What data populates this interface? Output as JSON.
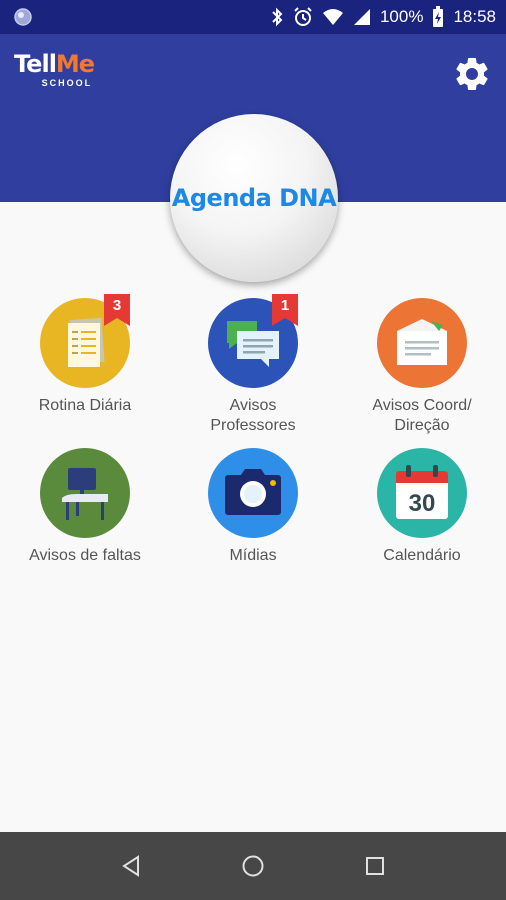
{
  "status_bar": {
    "battery": "100%",
    "time": "18:58"
  },
  "header": {
    "logo_tell": "Tell",
    "logo_me": "Me",
    "logo_sub": "SCHOOL"
  },
  "profile": {
    "name": "Agenda DNA"
  },
  "menu": [
    {
      "label": "Rotina Diária",
      "badge": "3",
      "color": "#e8b623",
      "icon": "document-icon"
    },
    {
      "label": "Avisos\nProfessores",
      "badge": "1",
      "color": "#2c53b8",
      "icon": "chat-bubbles-icon"
    },
    {
      "label": "Avisos Coord/\nDireção",
      "badge": null,
      "color": "#ec7434",
      "icon": "envelope-icon"
    },
    {
      "label": "Avisos de faltas",
      "badge": null,
      "color": "#5a8a3c",
      "icon": "school-desk-icon"
    },
    {
      "label": "Mídias",
      "badge": null,
      "color": "#2f8fe8",
      "icon": "camera-icon"
    },
    {
      "label": "Calendário",
      "badge": null,
      "color": "#2bb5a6",
      "icon": "calendar-icon"
    }
  ],
  "calendar_day": "30",
  "colors": {
    "status_bar": "#1a237e",
    "header": "#303f9f",
    "badge": "#e53935",
    "nav_bar": "#474747",
    "accent_text": "#1e88e5"
  }
}
